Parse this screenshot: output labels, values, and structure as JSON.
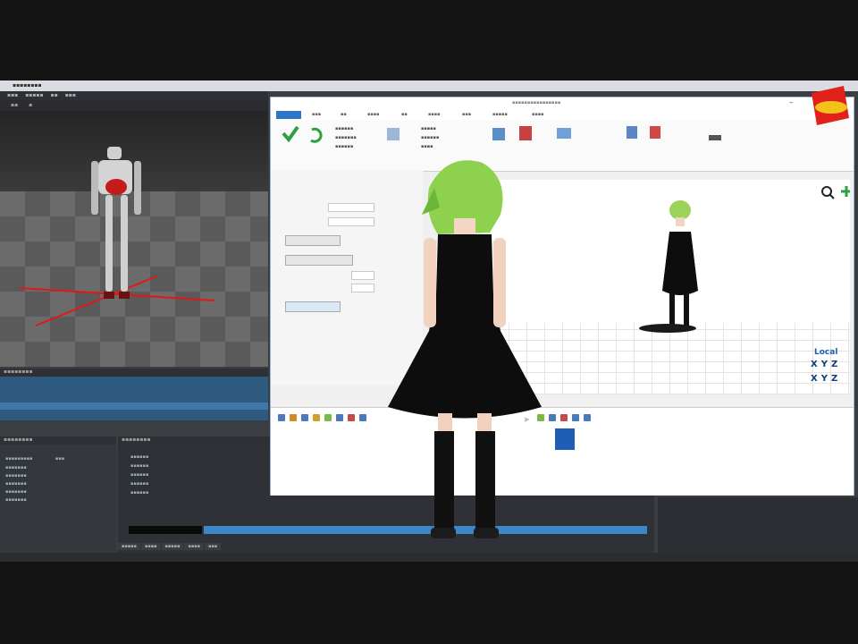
{
  "mmd": {
    "local_label": "Local",
    "axis_labels": {
      "x1": "X",
      "y1": "Y",
      "z1": "Z",
      "x2": "X",
      "y2": "Y",
      "z2": "Z"
    }
  },
  "colors": {
    "dark_bg": "#3a3d42",
    "timeline_blue": "#3f86c9",
    "accent_check": "#2ea043",
    "hair_green": "#8ed14f",
    "dress_black": "#0d0d0d"
  },
  "icons": [
    "check-icon",
    "refresh-icon",
    "search-icon",
    "plus-icon",
    "play-icon",
    "folder-icon"
  ]
}
